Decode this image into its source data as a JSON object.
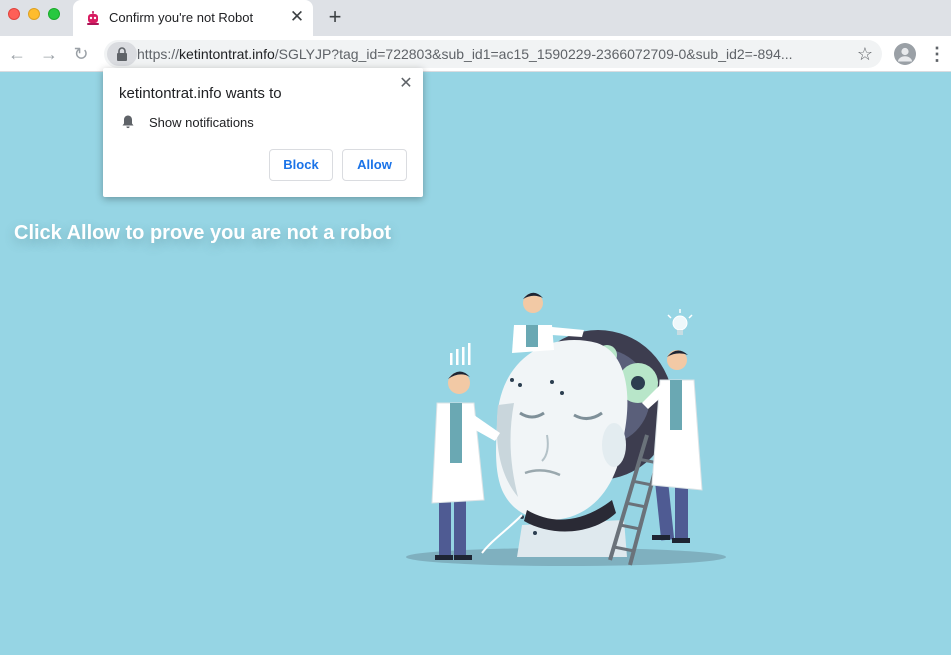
{
  "browser": {
    "tab": {
      "title": "Confirm you're not Robot",
      "close_glyph": "✕",
      "favicon": "robot-icon"
    },
    "new_tab_glyph": "+",
    "nav": {
      "back_glyph": "←",
      "forward_glyph": "→",
      "reload_glyph": "↻"
    },
    "address": {
      "scheme": "https://",
      "host": "ketintontrat.info",
      "path": "/SGLYJP?tag_id=722803&sub_id1=ac15_1590229-2366072709-0&sub_id2=-894..."
    },
    "bookmark_glyph": "☆",
    "menu_glyph": "⋮"
  },
  "popup": {
    "title": "ketintontrat.info wants to",
    "permission": "Show notifications",
    "close_glyph": "✕",
    "block_label": "Block",
    "allow_label": "Allow"
  },
  "page": {
    "headline": "Click Allow to prove you are not a robot",
    "background_color": "#96d5e4",
    "illustration": "scientists-building-robot-head"
  },
  "colors": {
    "accent": "#1a73e8",
    "traffic_close": "#fe5f57",
    "traffic_min": "#febc2e",
    "traffic_max": "#28c840"
  }
}
